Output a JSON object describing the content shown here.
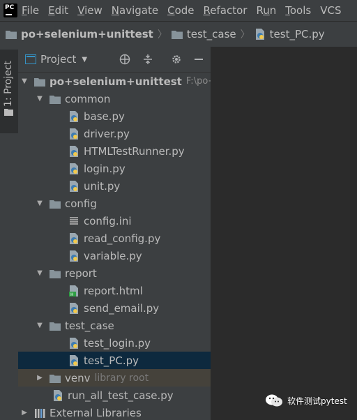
{
  "menubar": {
    "logo_text": "PC",
    "items": [
      {
        "label": "File",
        "mnemonic": "F",
        "rest": "ile"
      },
      {
        "label": "Edit",
        "mnemonic": "E",
        "rest": "dit"
      },
      {
        "label": "View",
        "mnemonic": "V",
        "rest": "iew"
      },
      {
        "label": "Navigate",
        "mnemonic": "N",
        "rest": "avigate"
      },
      {
        "label": "Code",
        "mnemonic": "C",
        "rest": "ode"
      },
      {
        "label": "Refactor",
        "mnemonic": "R",
        "rest": "efactor"
      },
      {
        "label": "Run",
        "mnemonic": "u",
        "pre": "R",
        "rest": "n"
      },
      {
        "label": "Tools",
        "mnemonic": "T",
        "rest": "ools"
      },
      {
        "label": "VCS",
        "mnemonic": "",
        "rest": "VCS"
      }
    ]
  },
  "breadcrumb": {
    "project": "po+selenium+unittest",
    "folder": "test_case",
    "file": "test_PC.py"
  },
  "tool_strip": {
    "tab_label": "1: Project"
  },
  "panel": {
    "title": "Project",
    "icons": [
      "globe-icon",
      "collapse-icon",
      "gear-icon",
      "minimize-icon"
    ]
  },
  "tree": {
    "root": {
      "label": "po+selenium+unittest",
      "path_hint": "F:\\po+"
    },
    "common": {
      "label": "common",
      "files": [
        "base.py",
        "driver.py",
        "HTMLTestRunner.py",
        "login.py",
        "unit.py"
      ]
    },
    "config": {
      "label": "config",
      "files": [
        "config.ini",
        "read_config.py",
        "variable.py"
      ]
    },
    "report": {
      "label": "report",
      "files": [
        "report.html",
        "send_email.py"
      ]
    },
    "test_case": {
      "label": "test_case",
      "files": [
        "test_login.py",
        "test_PC.py"
      ]
    },
    "venv": {
      "label": "venv",
      "hint": "library root"
    },
    "run_all": {
      "label": "run_all_test_case.py"
    },
    "external": {
      "label": "External Libraries"
    }
  },
  "watermark": {
    "text": "软件测试pytest"
  },
  "colors": {
    "menubar_bg": "#3c3f41",
    "editor_bg": "#2b2b2b",
    "selection": "#0d293e",
    "venv_highlight": "#45423b",
    "folder": "#87939a",
    "python_blue": "#3e7cb1",
    "python_yellow": "#f2c94c"
  }
}
